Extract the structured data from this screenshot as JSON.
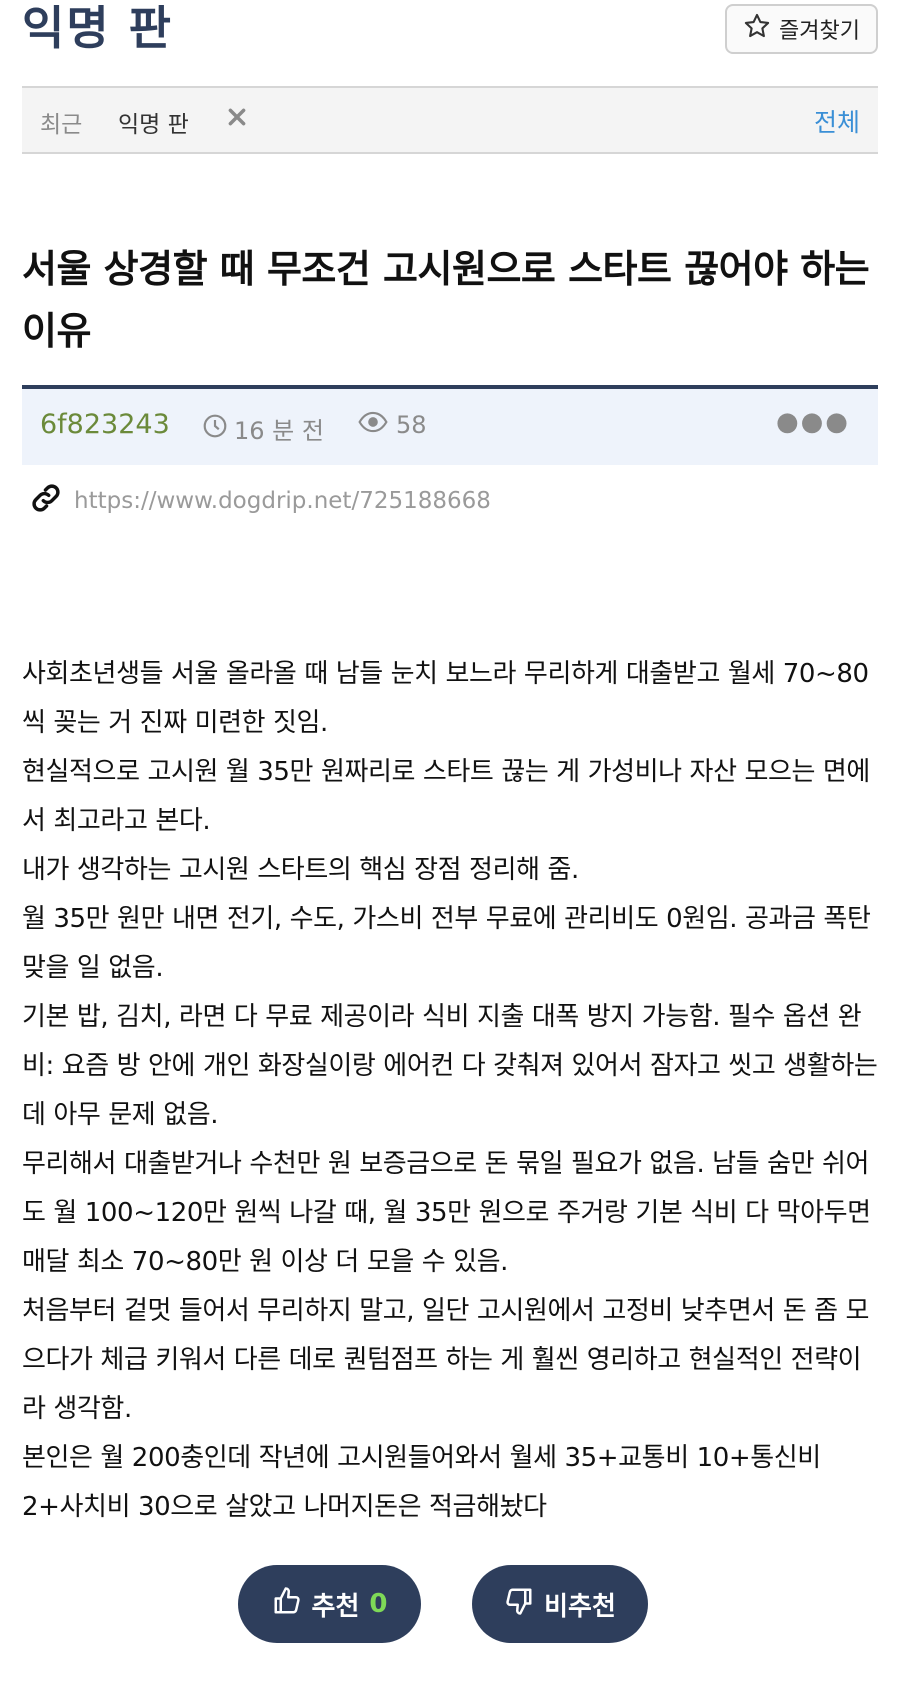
{
  "header": {
    "board_title": "익명 판",
    "favorite_label": "즐겨찾기"
  },
  "recent": {
    "label": "최근",
    "item": "익명 판",
    "all_label": "전체"
  },
  "post": {
    "title": "서울 상경할 때 무조건 고시원으로 스타트 끊어야 하는 이유",
    "author": "6f823243",
    "time": "16 분 전",
    "views": "58",
    "url": "https://www.dogdrip.net/725188668",
    "body": [
      "사회초년생들 서울 올라올 때 남들 눈치 보느라 무리하게 대출받고 월세 70~80씩 꽂는 거 진짜 미련한 짓임.",
      "현실적으로 고시원 월 35만 원짜리로 스타트 끊는 게 가성비나 자산 모으는 면에서 최고라고 본다.",
      "내가 생각하는 고시원 스타트의 핵심 장점 정리해 줌.",
      "월 35만 원만 내면 전기, 수도, 가스비 전부 무료에 관리비도 0원임. 공과금 폭탄 맞을 일 없음.",
      "기본 밥, 김치, 라면 다 무료 제공이라 식비 지출 대폭 방지 가능함. 필수 옵션 완비: 요즘 방 안에 개인 화장실이랑 에어컨 다 갖춰져 있어서 잠자고 씻고 생활하는 데 아무 문제 없음.",
      "무리해서 대출받거나 수천만 원 보증금으로 돈 묶일 필요가 없음. 남들 숨만 쉬어도 월 100~120만 원씩 나갈 때, 월 35만 원으로 주거랑 기본 식비 다 막아두면 매달 최소 70~80만 원 이상 더 모을 수 있음.",
      "처음부터 겉멋 들어서 무리하지 말고, 일단 고시원에서 고정비 낮추면서 돈 좀 모으다가 체급 키워서 다른 데로 퀀텀점프 하는 게 훨씬 영리하고 현실적인 전략이라 생각함.",
      "본인은 월 200충인데 작년에 고시원들어와서 월세 35+교통비 10+통신비 2+사치비 30으로 살았고 나머지돈은 적금해놨다"
    ]
  },
  "votes": {
    "up_label": "추천",
    "up_count": "0",
    "down_label": "비추천"
  },
  "colors": {
    "navy": "#2e3e5c",
    "author_green": "#6b8a3a",
    "link_blue": "#3a8fd6",
    "count_green": "#7ed957"
  },
  "icons": [
    "star-icon",
    "close-icon",
    "clock-icon",
    "eye-icon",
    "more-icon",
    "link-icon",
    "thumbs-up-icon",
    "thumbs-down-icon"
  ]
}
